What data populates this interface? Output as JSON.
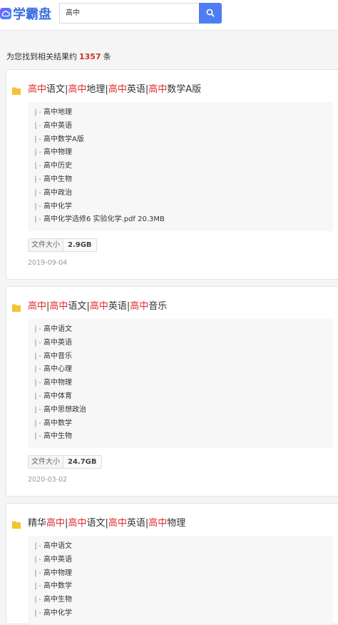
{
  "header": {
    "logo_text": "学霸盘",
    "search_value": "高中"
  },
  "summary": {
    "prefix": "为您找到相关结果约",
    "count": "1357",
    "suffix": "条"
  },
  "results": [
    {
      "title_parts": [
        {
          "t": "高中",
          "hl": true
        },
        {
          "t": "语文|",
          "hl": false
        },
        {
          "t": "高中",
          "hl": true
        },
        {
          "t": "地理|",
          "hl": false
        },
        {
          "t": "高中",
          "hl": true
        },
        {
          "t": "英语|",
          "hl": false
        },
        {
          "t": "高中",
          "hl": true
        },
        {
          "t": "数学A版",
          "hl": false
        }
      ],
      "files": [
        "高中地理",
        "高中英语",
        "高中数学A版",
        "高中物理",
        "高中历史",
        "高中生物",
        "高中政治",
        "高中化学",
        "高中化学选修6 实验化学.pdf 20.3MB"
      ],
      "size_label": "文件大小",
      "size": "2.9GB",
      "date": "2019-09-04"
    },
    {
      "title_parts": [
        {
          "t": "高中",
          "hl": true
        },
        {
          "t": "|",
          "hl": false
        },
        {
          "t": "高中",
          "hl": true
        },
        {
          "t": "语文|",
          "hl": false
        },
        {
          "t": "高中",
          "hl": true
        },
        {
          "t": "英语|",
          "hl": false
        },
        {
          "t": "高中",
          "hl": true
        },
        {
          "t": "音乐",
          "hl": false
        }
      ],
      "files": [
        "高中语文",
        "高中英语",
        "高中音乐",
        "高中心理",
        "高中物理",
        "高中体育",
        "高中思想政治",
        "高中数学",
        "高中生物"
      ],
      "size_label": "文件大小",
      "size": "24.7GB",
      "date": "2020-03-02"
    },
    {
      "title_parts": [
        {
          "t": "精华",
          "hl": false
        },
        {
          "t": "高中",
          "hl": true
        },
        {
          "t": "|",
          "hl": false
        },
        {
          "t": "高中",
          "hl": true
        },
        {
          "t": "语文|",
          "hl": false
        },
        {
          "t": "高中",
          "hl": true
        },
        {
          "t": "英语|",
          "hl": false
        },
        {
          "t": "高中",
          "hl": true
        },
        {
          "t": "物理",
          "hl": false
        }
      ],
      "files": [
        "高中语文",
        "高中英语",
        "高中物理",
        "高中数学",
        "高中生物",
        "高中化学"
      ],
      "size_label": "",
      "size": "",
      "date": ""
    }
  ],
  "colors": {
    "accent": "#4d7cf3",
    "highlight": "#e02b2b",
    "count": "#d0312d",
    "folder": "#f4c430"
  },
  "icons": {
    "logo": "cloud-icon",
    "search": "search-icon",
    "folder": "folder-icon"
  }
}
